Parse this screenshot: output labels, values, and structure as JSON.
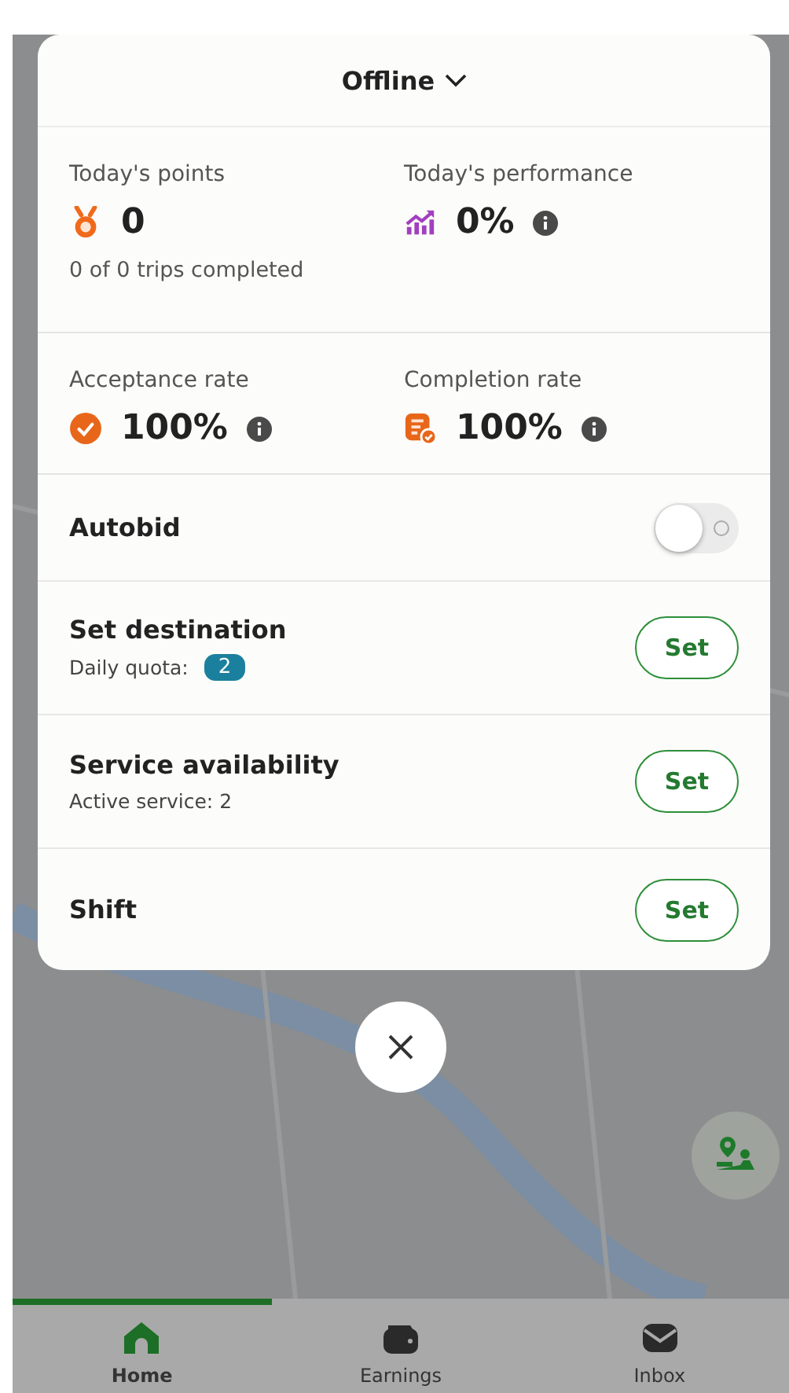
{
  "status": {
    "label": "Offline"
  },
  "stats": [
    {
      "kind": "points",
      "label": "Today's points",
      "value": "0",
      "note": "0 of 0 trips completed",
      "info": false
    },
    {
      "kind": "performance",
      "label": "Today's performance",
      "value": "0%",
      "info": true
    },
    {
      "kind": "acceptance",
      "label": "Acceptance rate",
      "value": "100%",
      "info": true
    },
    {
      "kind": "completion",
      "label": "Completion rate",
      "value": "100%",
      "info": true
    }
  ],
  "autobid": {
    "label": "Autobid",
    "on": false
  },
  "settings": [
    {
      "title": "Set destination",
      "subtitle": "Daily quota:",
      "badge": "2",
      "button": "Set"
    },
    {
      "title": "Service availability",
      "subtitle": "Active service: 2",
      "button": "Set"
    },
    {
      "title": "Shift",
      "button": "Set"
    }
  ],
  "nav": [
    {
      "kind": "home",
      "label": "Home",
      "selected": true
    },
    {
      "kind": "wallet",
      "label": "Earnings",
      "selected": false
    },
    {
      "kind": "inbox",
      "label": "Inbox",
      "selected": false
    }
  ]
}
